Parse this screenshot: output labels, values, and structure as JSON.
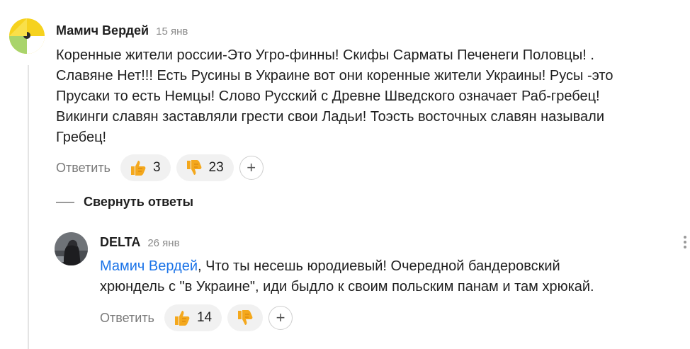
{
  "comment1": {
    "author": "Мамич Вердей",
    "date": "15 янв",
    "lines": [
      "Коренные жители россии-Это Угро-финны! Скифы Сарматы Печенеги Половцы! .",
      "Славяне Нет!!! Есть Русины в Украине вот они коренные жители Украины! Русы -это",
      "Прусаки то есть Немцы! Слово Русский с Древне Шведского означает Раб-гребец!",
      "Викинги славян заставляли грести свои Ладьи! Тоэсть восточных славян называли",
      "Гребец!"
    ],
    "reply_label": "Ответить",
    "likes": "3",
    "dislikes": "23"
  },
  "collapse_label": "Свернуть ответы",
  "comment2": {
    "author": "DELTA",
    "date": "26 янв",
    "mention": "Мамич Вердей",
    "text_line1_rest": ", Что ты несешь юродиевый! Очередной бандеровский",
    "text_line2": "хрюндель с \"в Украине\", иди быдло к своим польским панам и там хрюкай.",
    "reply_label": "Ответить",
    "likes": "14"
  },
  "icons": {
    "plus": "+",
    "thumb_color": "#f4a81d"
  }
}
